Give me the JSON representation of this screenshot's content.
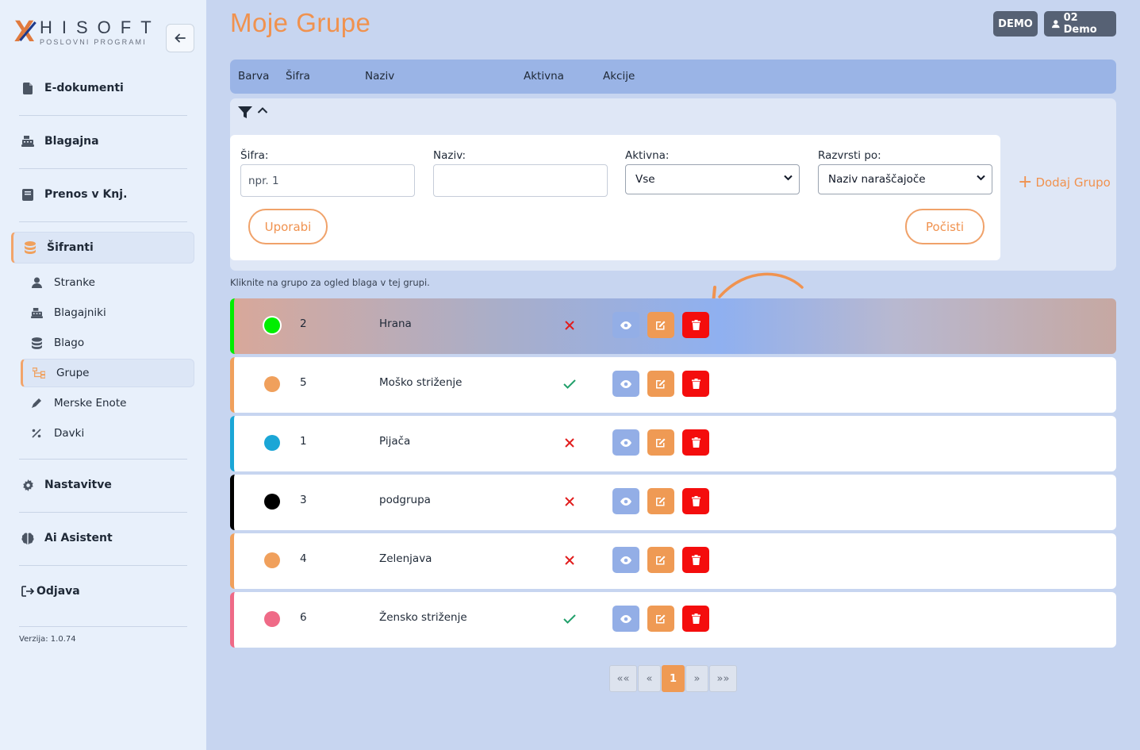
{
  "brand": {
    "name": "HISOFT",
    "tagline": "POSLOVNI PROGRAMI"
  },
  "sidebar": {
    "items": [
      {
        "label": "E-dokumenti",
        "icon": "file-icon"
      },
      {
        "label": "Blagajna",
        "icon": "cash-register-icon"
      },
      {
        "label": "Prenos v Knj.",
        "icon": "book-icon"
      },
      {
        "label": "Šifranti",
        "icon": "database-icon",
        "active": true
      },
      {
        "label": "Nastavitve",
        "icon": "gear-icon"
      },
      {
        "label": "Ai Asistent",
        "icon": "brain-icon"
      },
      {
        "label": "Odjava",
        "icon": "logout-icon"
      }
    ],
    "subitems": [
      {
        "label": "Stranke",
        "icon": "user-icon"
      },
      {
        "label": "Blagajniki",
        "icon": "cash-register-icon"
      },
      {
        "label": "Blago",
        "icon": "database-icon"
      },
      {
        "label": "Grupe",
        "icon": "sitemap-icon",
        "active": true
      },
      {
        "label": "Merske Enote",
        "icon": "pencil-ruler-icon"
      },
      {
        "label": "Davki",
        "icon": "percent-icon"
      }
    ],
    "version": "Verzija: 1.0.74"
  },
  "header": {
    "title": "Moje Grupe",
    "demo_badge": "DEMO",
    "user_label": "02 Demo"
  },
  "table": {
    "columns": [
      "Barva",
      "Šifra",
      "Naziv",
      "Aktivna",
      "Akcije"
    ]
  },
  "filters": {
    "sifra_label": "Šifra:",
    "sifra_placeholder": "npr. 1",
    "naziv_label": "Naziv:",
    "naziv_value": "",
    "aktivna_label": "Aktivna:",
    "aktivna_value": "Vse",
    "razvrsti_label": "Razvrsti po:",
    "razvrsti_value": "Naziv naraščajoče",
    "apply_label": "Uporabi",
    "clear_label": "Počisti",
    "add_label": "Dodaj Grupo"
  },
  "hint": "Kliknite na grupo za ogled blaga v tej grupi.",
  "groups": [
    {
      "color": "#00ee00",
      "code": "2",
      "name": "Hrana",
      "active": false
    },
    {
      "color": "#f0a05c",
      "code": "5",
      "name": "Moško striženje",
      "active": true
    },
    {
      "color": "#1ba6d6",
      "code": "1",
      "name": "Pijača",
      "active": false
    },
    {
      "color": "#000000",
      "code": "3",
      "name": "podgrupa",
      "active": false
    },
    {
      "color": "#f0a05c",
      "code": "4",
      "name": "Zelenjava",
      "active": false
    },
    {
      "color": "#ef6a87",
      "code": "6",
      "name": "Žensko striženje",
      "active": true
    }
  ],
  "pagination": {
    "first": "««",
    "prev": "«",
    "current": "1",
    "next": "»",
    "last": "»»"
  },
  "colors": {
    "accent": "#f0924f",
    "danger": "#f40d0d",
    "view": "#93aee6",
    "success": "#22a06b"
  }
}
